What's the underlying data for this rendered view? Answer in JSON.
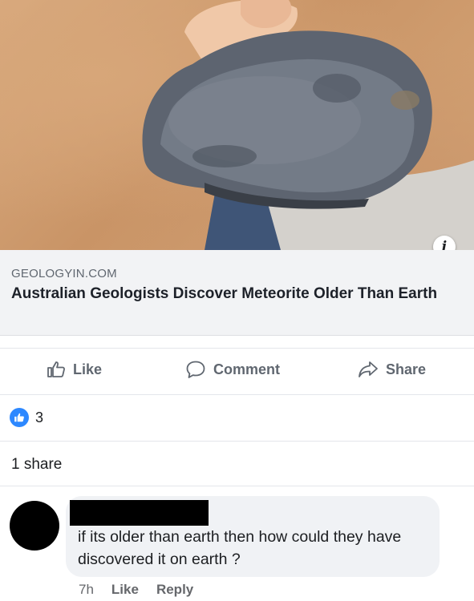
{
  "post_image": {
    "icon": "info-icon"
  },
  "link_preview": {
    "domain": "GEOLOGYIN.COM",
    "title": "Australian Geologists Discover Meteorite Older Than Earth"
  },
  "actions": {
    "like": "Like",
    "comment": "Comment",
    "share": "Share"
  },
  "reactions": {
    "count": "3",
    "color": "#2d88ff"
  },
  "shares": "1 share",
  "comment": {
    "text": "if its older than earth then how could they have discovered it on earth ?",
    "time": "7h",
    "like": "Like",
    "reply": "Reply"
  }
}
